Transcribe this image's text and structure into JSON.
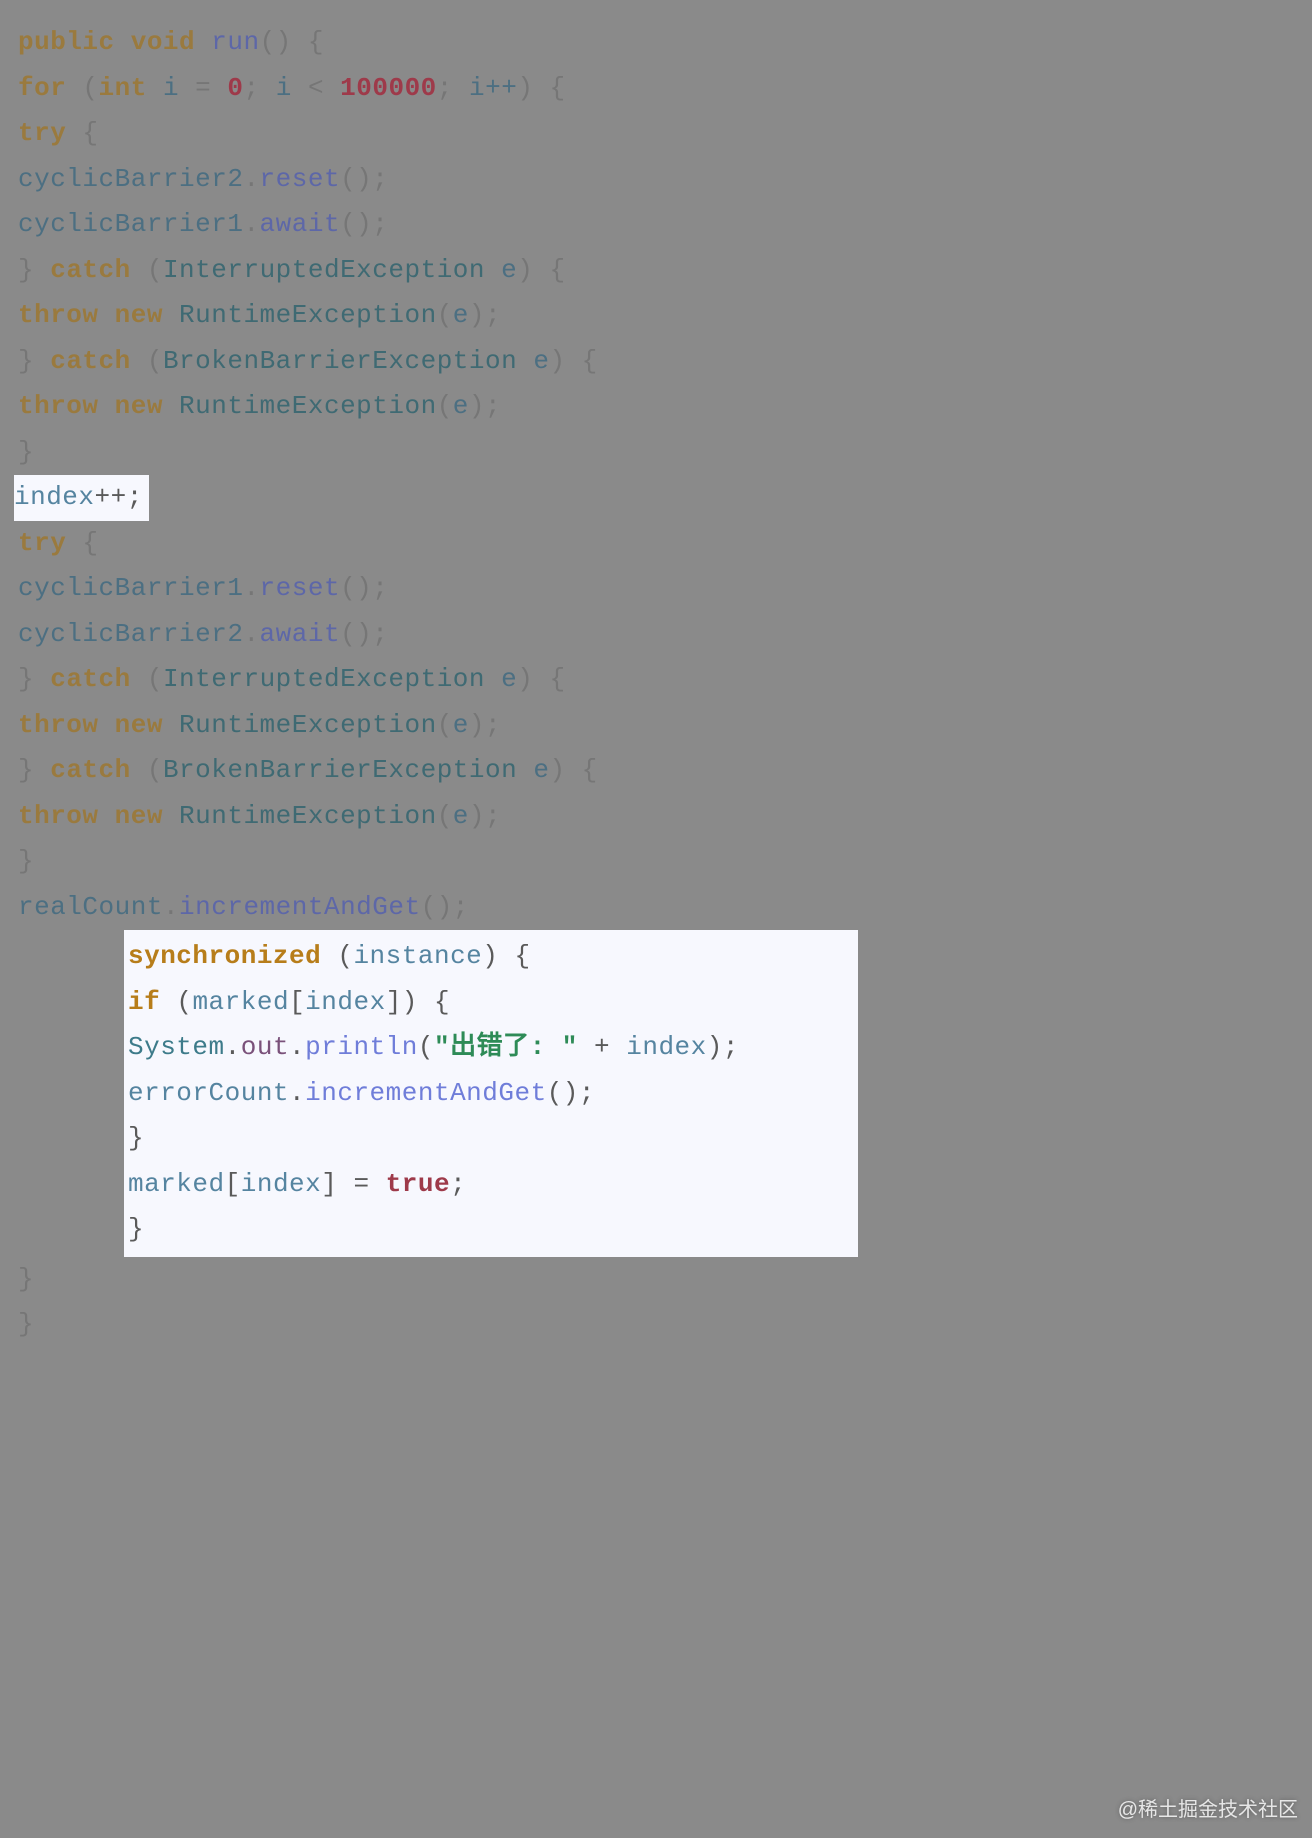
{
  "code": {
    "method_modifiers": "public void",
    "method_name": "run",
    "for_kw": "for",
    "int_type": "int",
    "loop_var": "i",
    "zero": "0",
    "lt": "<",
    "limit": "100000",
    "incr": "i++",
    "try_kw": "try",
    "catch_kw": "catch",
    "throw_kw": "throw",
    "new_kw": "new",
    "cyclicBarrier1": "cyclicBarrier1",
    "cyclicBarrier2": "cyclicBarrier2",
    "reset_fn": "reset",
    "await_fn": "await",
    "InterruptedException": "InterruptedException",
    "BrokenBarrierException": "BrokenBarrierException",
    "RuntimeException": "RuntimeException",
    "e": "e",
    "index": "index",
    "realCount": "realCount",
    "incrementAndGet": "incrementAndGet",
    "synchronized_kw": "synchronized",
    "instance": "instance",
    "if_kw": "if",
    "marked": "marked",
    "System": "System",
    "out": "out",
    "println": "println",
    "err_str": "\"出错了: \"",
    "plus": "+",
    "errorCount": "errorCount",
    "true_kw": "true",
    "eq": "="
  },
  "watermark": "@稀土掘金技术社区"
}
